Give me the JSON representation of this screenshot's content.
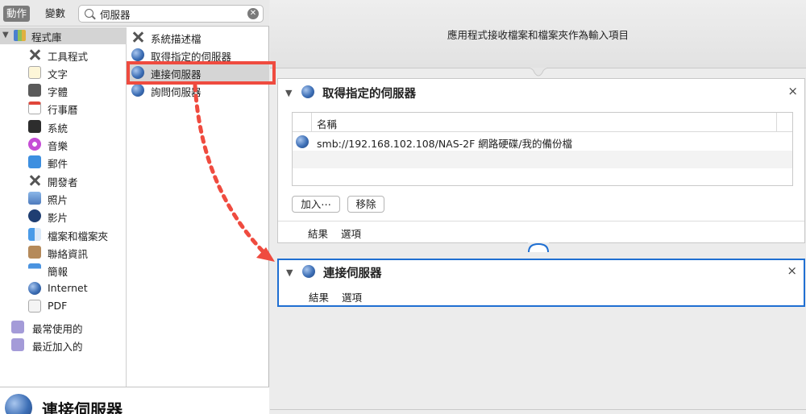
{
  "toolbar": {
    "tab_actions": "動作",
    "tab_variables": "變數"
  },
  "search": {
    "value": "伺服器",
    "placeholder": ""
  },
  "library": {
    "root_label": "程式庫",
    "categories": [
      "工具程式",
      "文字",
      "字體",
      "行事曆",
      "系統",
      "音樂",
      "郵件",
      "開發者",
      "照片",
      "影片",
      "檔案和檔案夾",
      "聯絡資訊",
      "簡報",
      "Internet",
      "PDF"
    ],
    "smart_groups": [
      "最常使用的",
      "最近加入的"
    ]
  },
  "actions": [
    "系統描述檔",
    "取得指定的伺服器",
    "連接伺服器",
    "詢問伺服器"
  ],
  "selected_action": "連接伺服器",
  "description": {
    "title": "連接伺服器"
  },
  "workflow": {
    "input_label": "應用程式接收檔案和檔案夾作為輸入項目",
    "card1": {
      "title": "取得指定的伺服器",
      "column_header": "名稱",
      "row": "smb://192.168.102.108/NAS-2F 網路硬碟/我的備份檔",
      "add_label": "加入⋯",
      "remove_label": "移除",
      "tab_results": "結果",
      "tab_options": "選項"
    },
    "card2": {
      "title": "連接伺服器",
      "tab_results": "結果",
      "tab_options": "選項"
    }
  },
  "colors": {
    "highlight": "#ef4b3f",
    "selection": "#1f6fd2"
  },
  "icons": {
    "close": "×",
    "clear": "✕",
    "disclosure": "▼"
  }
}
